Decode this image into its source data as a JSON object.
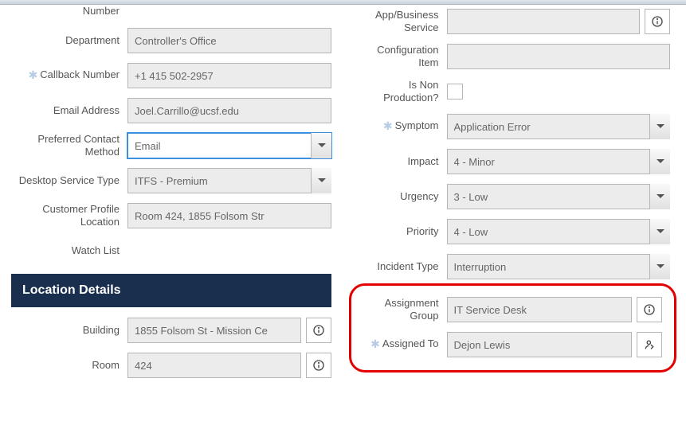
{
  "left": {
    "number_label": "Number",
    "department_label": "Department",
    "department_value": "Controller's Office",
    "callback_label": "Callback Number",
    "callback_value": "+1 415 502-2957",
    "email_label": "Email Address",
    "email_value": "Joel.Carrillo@ucsf.edu",
    "contact_method_label": "Preferred Contact Method",
    "contact_method_value": "Email",
    "desktop_label": "Desktop Service Type",
    "desktop_value": "ITFS - Premium",
    "profile_loc_label": "Customer Profile Location",
    "profile_loc_value": "Room 424, 1855 Folsom Str",
    "watch_label": "Watch List"
  },
  "location_section": "Location Details",
  "location": {
    "building_label": "Building",
    "building_value": "1855 Folsom St - Mission Ce",
    "room_label": "Room",
    "room_value": "424"
  },
  "right": {
    "app_service_label": "App/Business Service",
    "config_label": "Configuration Item",
    "nonprod_label": "Is Non Production?",
    "symptom_label": "Symptom",
    "symptom_value": "Application Error",
    "impact_label": "Impact",
    "impact_value": "4 - Minor",
    "urgency_label": "Urgency",
    "urgency_value": "3 - Low",
    "priority_label": "Priority",
    "priority_value": "4 - Low",
    "incident_type_label": "Incident Type",
    "incident_type_value": "Interruption",
    "assign_group_label": "Assignment Group",
    "assign_group_value": "IT Service Desk",
    "assigned_to_label": "Assigned To",
    "assigned_to_value": "Dejon Lewis"
  }
}
